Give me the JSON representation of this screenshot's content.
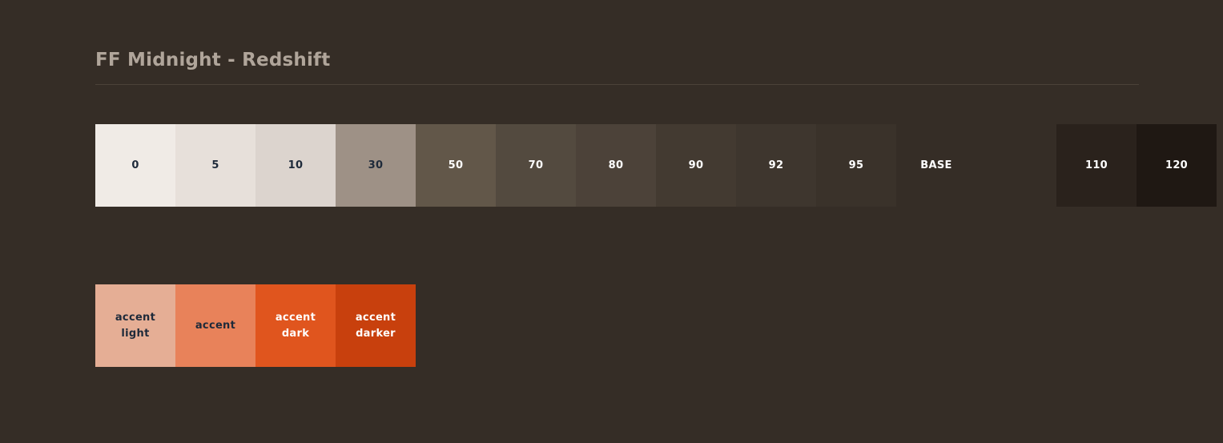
{
  "page": {
    "background_color": "#352d26",
    "title": "FF Midnight - Redshift",
    "title_color": "#b0a59a",
    "rule_color": "#4b4239"
  },
  "neutral_row": {
    "name": "neutral-ramp",
    "swatches": [
      {
        "label": "0",
        "color": "#f0ebe6",
        "text_color": "#1e2a3a"
      },
      {
        "label": "5",
        "color": "#e7e0da",
        "text_color": "#1e2a3a"
      },
      {
        "label": "10",
        "color": "#dcd4ce",
        "text_color": "#1e2a3a"
      },
      {
        "label": "30",
        "color": "#9e9186",
        "text_color": "#1e2a3a"
      },
      {
        "label": "50",
        "color": "#625749",
        "text_color": "#ffffff"
      },
      {
        "label": "70",
        "color": "#534a3f",
        "text_color": "#ffffff"
      },
      {
        "label": "80",
        "color": "#4c4239",
        "text_color": "#ffffff"
      },
      {
        "label": "90",
        "color": "#433a31",
        "text_color": "#ffffff"
      },
      {
        "label": "92",
        "color": "#3e362e",
        "text_color": "#ffffff"
      },
      {
        "label": "95",
        "color": "#3a322a",
        "text_color": "#ffffff"
      },
      {
        "label": "BASE",
        "color": "#352d26",
        "text_color": "#ffffff"
      },
      {
        "label": "",
        "color": "transparent",
        "text_color": "#ffffff",
        "spacer": true
      },
      {
        "label": "110",
        "color": "#2a221c",
        "text_color": "#ffffff"
      },
      {
        "label": "120",
        "color": "#1f1813",
        "text_color": "#ffffff"
      }
    ]
  },
  "accent_row": {
    "name": "accent-ramp",
    "swatches": [
      {
        "label": "accent\nlight",
        "color": "#e5ae95",
        "text_color": "#1e2a3a"
      },
      {
        "label": "accent",
        "color": "#e8825a",
        "text_color": "#1e2a3a"
      },
      {
        "label": "accent\ndark",
        "color": "#e0551e",
        "text_color": "#ffffff"
      },
      {
        "label": "accent\ndarker",
        "color": "#c8400d",
        "text_color": "#ffffff"
      }
    ]
  }
}
